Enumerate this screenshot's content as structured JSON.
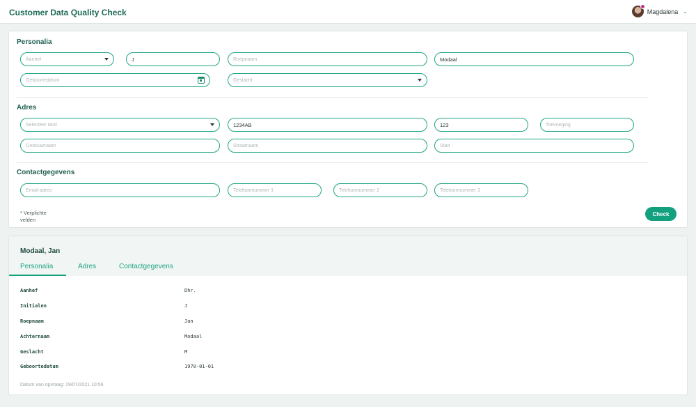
{
  "app": {
    "title": "Customer Data Quality Check"
  },
  "user": {
    "name": "Magdalena",
    "avatar_icon": "user-avatar",
    "status_color": "#c2338d"
  },
  "colors": {
    "accent": "#13a07f",
    "border": "#1fa585",
    "title": "#1e6a57"
  },
  "form": {
    "personalia": {
      "title": "Personalia",
      "aanhef": {
        "placeholder": "Aanhef",
        "value": ""
      },
      "initialen": {
        "placeholder": "",
        "value": "J"
      },
      "roepnaam": {
        "placeholder": "Roepnaam",
        "value": ""
      },
      "achternaam": {
        "placeholder": "",
        "value": "Modaal"
      },
      "geboortedatum": {
        "placeholder": "Geboortedatum",
        "value": ""
      },
      "geslacht": {
        "placeholder": "Geslacht",
        "value": ""
      }
    },
    "adres": {
      "title": "Adres",
      "land": {
        "placeholder": "Selecteer land",
        "value": ""
      },
      "postcode": {
        "placeholder": "",
        "value": "1234AB"
      },
      "huisnummer": {
        "placeholder": "",
        "value": "123"
      },
      "toevoeging": {
        "placeholder": "Toevoeging",
        "value": ""
      },
      "gebouwnaam": {
        "placeholder": "Gebouwnaam",
        "value": ""
      },
      "straatnaam": {
        "placeholder": "Straatnaam",
        "value": ""
      },
      "stad": {
        "placeholder": "Stad",
        "value": ""
      }
    },
    "contact": {
      "title": "Contactgegevens",
      "email": {
        "placeholder": "Email-adres",
        "value": ""
      },
      "tel1": {
        "placeholder": "Telefoonnummer 1",
        "value": ""
      },
      "tel2": {
        "placeholder": "Telefoonnummer 2",
        "value": ""
      },
      "tel3": {
        "placeholder": "Telefoonnummer 3",
        "value": ""
      }
    },
    "required_note": "* Verplichte velden",
    "check_label": "Check"
  },
  "result": {
    "name": "Modaal, Jan",
    "tabs": [
      "Personalia",
      "Adres",
      "Contactgegevens"
    ],
    "active_tab": "Personalia",
    "rows": [
      {
        "label": "Aanhef",
        "value": "Dhr."
      },
      {
        "label": "Initialen",
        "value": "J"
      },
      {
        "label": "Roepnaam",
        "value": "Jan"
      },
      {
        "label": "Achternaam",
        "value": "Modaal"
      },
      {
        "label": "Geslacht",
        "value": "M"
      },
      {
        "label": "Geboortedatum",
        "value": "1970-01-01"
      }
    ],
    "footnote": "Datum van opvraag: 19/07/2021 10:56"
  }
}
